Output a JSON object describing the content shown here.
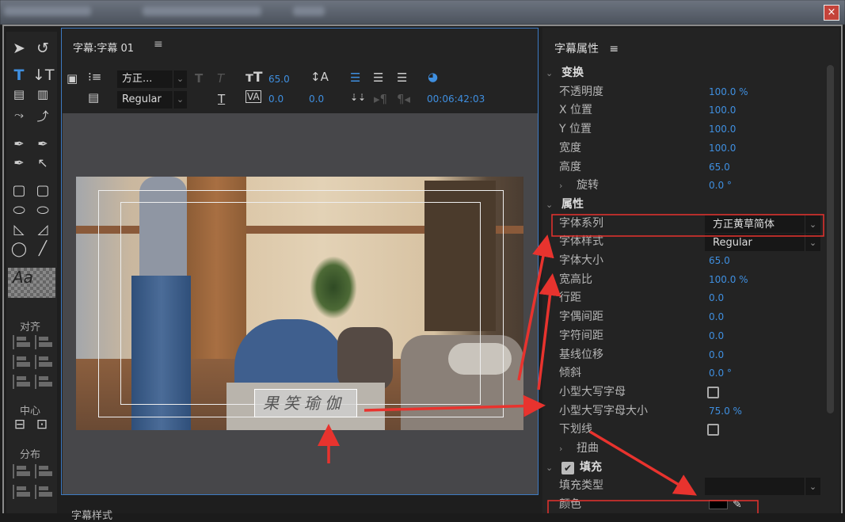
{
  "window": {
    "close_label": "×"
  },
  "tools": {
    "align_label": "对齐",
    "center_label": "中心",
    "distribute_label": "分布"
  },
  "editor": {
    "title": "字幕:字幕 01",
    "menu_icon": "≡",
    "font_family": "方正...",
    "font_style": "Regular",
    "font_size": "65.0",
    "kerning": "0.0",
    "leading": "0.0",
    "timecode": "00:06:42:03",
    "subtitle_text": "果笑瑜伽"
  },
  "properties": {
    "title": "字幕属性",
    "menu_icon": "≡",
    "rows": [
      {
        "type": "head",
        "label": "变换"
      },
      {
        "label": "不透明度",
        "value": "100.0 %"
      },
      {
        "label": "X 位置",
        "value": "100.0"
      },
      {
        "label": "Y 位置",
        "value": "100.0"
      },
      {
        "label": "宽度",
        "value": "100.0"
      },
      {
        "label": "高度",
        "value": "65.0"
      },
      {
        "type": "sub",
        "label": "旋转",
        "value": "0.0 °"
      },
      {
        "type": "head",
        "label": "属性"
      },
      {
        "type": "dropdown",
        "label": "字体系列",
        "value": "方正黄草简体"
      },
      {
        "type": "dropdown",
        "label": "字体样式",
        "value": "Regular"
      },
      {
        "label": "字体大小",
        "value": "65.0"
      },
      {
        "label": "宽高比",
        "value": "100.0 %"
      },
      {
        "label": "行距",
        "value": "0.0"
      },
      {
        "label": "字偶间距",
        "value": "0.0"
      },
      {
        "label": "字符间距",
        "value": "0.0"
      },
      {
        "label": "基线位移",
        "value": "0.0"
      },
      {
        "label": "倾斜",
        "value": "0.0 °"
      },
      {
        "type": "checkbox",
        "label": "小型大写字母",
        "checked": false
      },
      {
        "label": "小型大写字母大小",
        "value": "75.0 %"
      },
      {
        "type": "checkbox",
        "label": "下划线",
        "checked": false
      },
      {
        "type": "sub",
        "label": "扭曲"
      },
      {
        "type": "headcheck",
        "label": "填充",
        "checked": true
      },
      {
        "type": "dropdown",
        "label": "填充类型",
        "value": ""
      },
      {
        "type": "color",
        "label": "颜色",
        "color": "#000000"
      }
    ]
  },
  "bottom_panel": {
    "title": "字幕样式"
  },
  "annotation_color": "#e8332e"
}
